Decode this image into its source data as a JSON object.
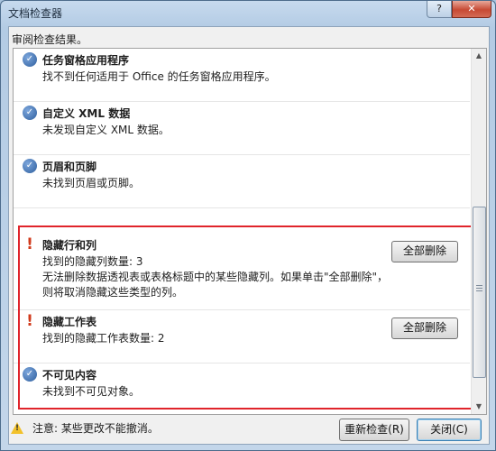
{
  "window": {
    "title": "文档检查器",
    "help_label": "?",
    "close_label": "✕"
  },
  "subtitle": "审阅检查结果。",
  "sections": [
    {
      "status": "ok",
      "title": "任务窗格应用程序",
      "lines": [
        "找不到任何适用于 Office 的任务窗格应用程序。"
      ]
    },
    {
      "status": "ok",
      "title": "自定义 XML 数据",
      "lines": [
        "未发现自定义 XML 数据。"
      ]
    },
    {
      "status": "ok",
      "title": "页眉和页脚",
      "lines": [
        "未找到页眉或页脚。"
      ]
    },
    {
      "status": "warning",
      "title": "隐藏行和列",
      "lines": [
        "找到的隐藏列数量: 3",
        "无法删除数据透视表或表格标题中的某些隐藏列。如果单击\"全部删除\"，",
        "则将取消隐藏这些类型的列。"
      ],
      "button": "全部删除"
    },
    {
      "status": "warning",
      "title": "隐藏工作表",
      "lines": [
        "找到的隐藏工作表数量: 2"
      ],
      "button": "全部删除"
    },
    {
      "status": "ok",
      "title": "不可见内容",
      "lines": [
        "未找到不可见对象。"
      ]
    }
  ],
  "icons": {
    "ok": "check-circle-icon",
    "warning": "exclamation-icon",
    "note": "warning-triangle-icon"
  },
  "colors": {
    "highlight_border": "#e0242b",
    "warning_icon": "#d13a1c",
    "ok_icon": "#2f5f9e"
  },
  "footer": {
    "note": "注意: 某些更改不能撤消。",
    "recheck_label": "重新检查(R)",
    "close_label": "关闭(C)"
  }
}
